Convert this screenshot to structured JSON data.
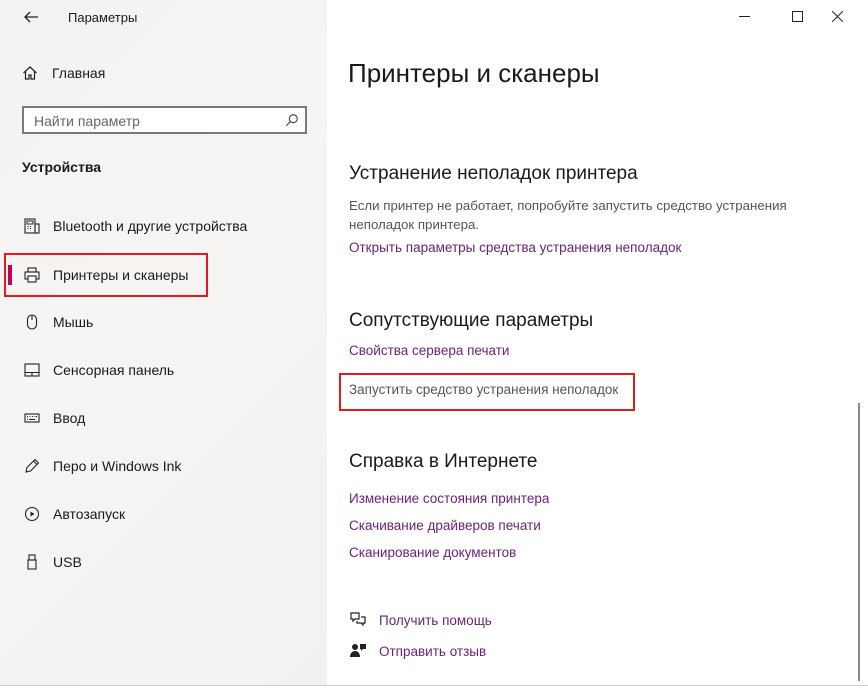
{
  "app": {
    "title": "Параметры"
  },
  "sidebar": {
    "home_label": "Главная",
    "search_placeholder": "Найти параметр",
    "section_title": "Устройства",
    "items": [
      {
        "label": "Bluetooth и другие устройства",
        "icon": "bluetooth-devices-icon"
      },
      {
        "label": "Принтеры и сканеры",
        "icon": "printer-icon",
        "active": true
      },
      {
        "label": "Мышь",
        "icon": "mouse-icon"
      },
      {
        "label": "Сенсорная панель",
        "icon": "touchpad-icon"
      },
      {
        "label": "Ввод",
        "icon": "keyboard-icon"
      },
      {
        "label": "Перо и Windows Ink",
        "icon": "pen-icon"
      },
      {
        "label": "Автозапуск",
        "icon": "autoplay-icon"
      },
      {
        "label": "USB",
        "icon": "usb-icon"
      }
    ]
  },
  "main": {
    "title": "Принтеры и сканеры",
    "troubleshoot": {
      "heading": "Устранение неполадок принтера",
      "description": "Если принтер не работает, попробуйте запустить средство устранения неполадок принтера.",
      "link": "Открыть параметры средства устранения неполадок"
    },
    "related": {
      "heading": "Сопутствующие параметры",
      "links": [
        "Свойства сервера печати",
        "Запустить средство устранения неполадок"
      ]
    },
    "web_help": {
      "heading": "Справка в Интернете",
      "links": [
        "Изменение состояния принтера",
        "Скачивание драйверов печати",
        "Сканирование документов"
      ]
    },
    "get_help": "Получить помощь",
    "feedback": "Отправить отзыв"
  },
  "colors": {
    "accent": "#c30052",
    "link": "#6b1f7c",
    "highlight": "#e21b1b"
  }
}
